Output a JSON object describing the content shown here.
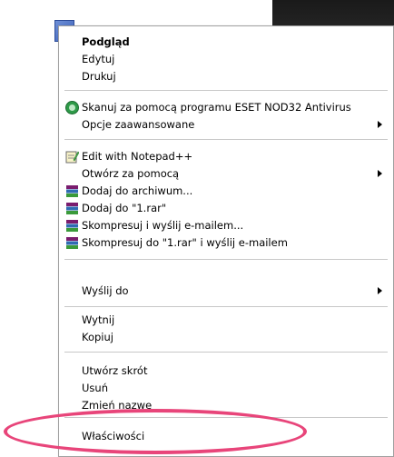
{
  "menu": {
    "items": [
      {
        "label": "Podgląd"
      },
      {
        "label": "Edytuj"
      },
      {
        "label": "Drukuj"
      },
      {
        "label": "Skanuj za pomocą programu ESET NOD32 Antivirus"
      },
      {
        "label": "Opcje zaawansowane"
      },
      {
        "label": "Edit with Notepad++"
      },
      {
        "label": "Otwórz za pomocą"
      },
      {
        "label": "Dodaj do archiwum..."
      },
      {
        "label": "Dodaj do \"1.rar\""
      },
      {
        "label": "Skompresuj i wyślij e-mailem..."
      },
      {
        "label": "Skompresuj do \"1.rar\" i wyślij e-mailem"
      },
      {
        "label": "Wyślij do"
      },
      {
        "label": "Wytnij"
      },
      {
        "label": "Kopiuj"
      },
      {
        "label": "Utwórz skrót"
      },
      {
        "label": "Usuń"
      },
      {
        "label": "Zmień nazwę"
      },
      {
        "label": "Właściwości"
      }
    ]
  },
  "colors": {
    "highlight_ellipse": "#e8457a",
    "eset_icon": "#2e9a48",
    "winrar_icon": "#8b1a6b"
  }
}
